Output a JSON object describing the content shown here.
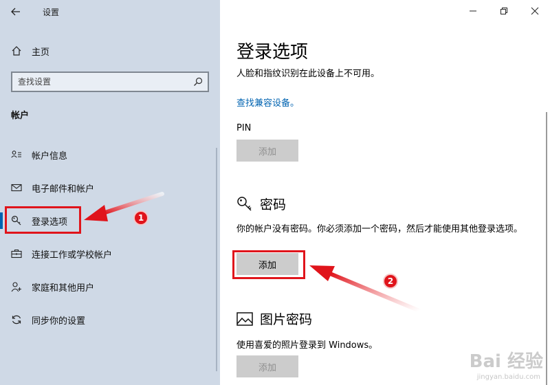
{
  "window": {
    "title": "设置",
    "back_icon": "arrow-left-icon",
    "minimize_icon": "minimize-icon",
    "maximize_icon": "restore-icon",
    "close_icon": "close-icon"
  },
  "sidebar": {
    "home_label": "主页",
    "search_placeholder": "查找设置",
    "section_title": "帐户",
    "items": [
      {
        "label": "帐户信息",
        "icon": "account-info-icon",
        "active": false
      },
      {
        "label": "电子邮件和帐户",
        "icon": "mail-icon",
        "active": false
      },
      {
        "label": "登录选项",
        "icon": "key-icon",
        "active": true
      },
      {
        "label": "连接工作或学校帐户",
        "icon": "briefcase-icon",
        "active": false
      },
      {
        "label": "家庭和其他用户",
        "icon": "person-add-icon",
        "active": false
      },
      {
        "label": "同步你的设置",
        "icon": "sync-icon",
        "active": false
      }
    ]
  },
  "main": {
    "title": "登录选项",
    "face_fingerprint_text": "人脸和指纹识别在此设备上不可用。",
    "compatible_link": "查找兼容设备。",
    "pin": {
      "label": "PIN",
      "add_label": "添加"
    },
    "password": {
      "title": "密码",
      "description": "你的帐户没有密码。你必须添加一个密码，然后才能使用其他登录选项。",
      "add_label": "添加"
    },
    "picture_password": {
      "title": "图片密码",
      "description": "使用喜爱的照片登录到 Windows。",
      "add_label": "添加"
    }
  },
  "annotations": {
    "badge1": "1",
    "badge2": "2",
    "color": "#e0141b"
  },
  "watermark": {
    "main": "Bai 经验",
    "sub": "jingyan.baidu.com"
  },
  "colors": {
    "sidebar_bg": "#cfd9e6",
    "accent": "#0063b1",
    "button_bg": "#cccccc"
  }
}
